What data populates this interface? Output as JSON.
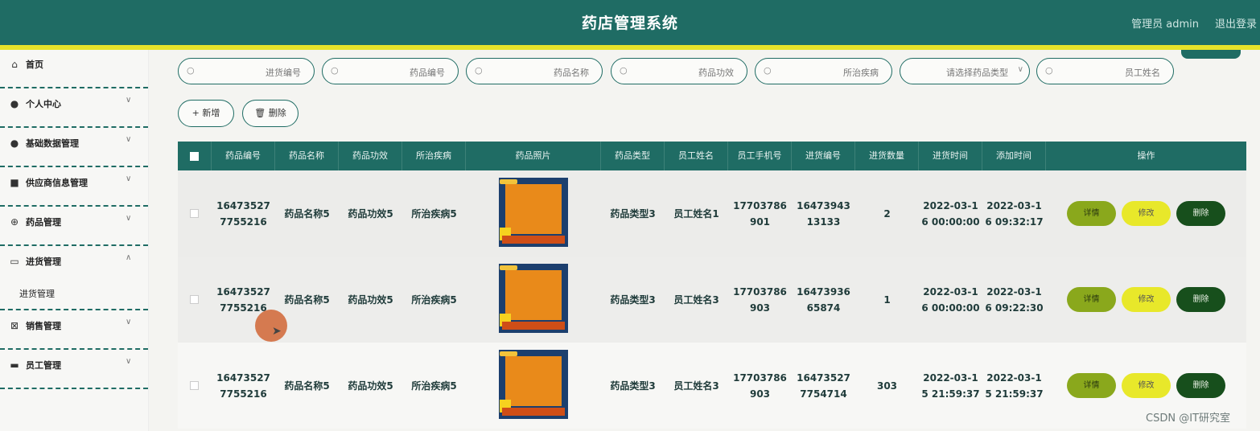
{
  "header": {
    "title": "药店管理系统",
    "admin_label": "管理员 admin",
    "logout_label": "退出登录"
  },
  "sidebar": {
    "items": [
      {
        "label": "首页",
        "icon": "home-icon"
      },
      {
        "label": "个人中心",
        "icon": "user-icon"
      },
      {
        "label": "基础数据管理",
        "icon": "pin-icon"
      },
      {
        "label": "供应商信息管理",
        "icon": "printer-icon"
      },
      {
        "label": "药品管理",
        "icon": "globe-icon"
      },
      {
        "label": "进货管理",
        "icon": "chat-icon"
      },
      {
        "label": "销售管理",
        "icon": "cross-icon"
      },
      {
        "label": "员工管理",
        "icon": "ticket-icon"
      }
    ],
    "submenu": {
      "label": "进货管理"
    }
  },
  "search": {
    "purchase_no": "进货编号",
    "drug_no": "药品编号",
    "drug_name": "药品名称",
    "drug_effect": "药品功效",
    "disease": "所治疾病",
    "drug_type": "请选择药品类型",
    "staff_name": "员工姓名"
  },
  "actions": {
    "add": "+ 新增",
    "delete": "🗑 删除"
  },
  "table": {
    "headers": [
      "药品编号",
      "药品名称",
      "药品功效",
      "所治疾病",
      "药品照片",
      "药品类型",
      "员工姓名",
      "员工手机号",
      "进货编号",
      "进货数量",
      "进货时间",
      "添加时间",
      "操作"
    ],
    "rows": [
      {
        "drug_no": "16473527 7755216",
        "drug_name": "药品名称5",
        "effect": "药品功效5",
        "disease": "所治疾病5",
        "type": "药品类型3",
        "staff": "员工姓名1",
        "phone": "17703786 901",
        "purchase_no": "16473943 13133",
        "qty": "2",
        "purchase_time": "2022-03-1 6 00:00:00",
        "add_time": "2022-03-1 6 09:32:17"
      },
      {
        "drug_no": "16473527 7755216",
        "drug_name": "药品名称5",
        "effect": "药品功效5",
        "disease": "所治疾病5",
        "type": "药品类型3",
        "staff": "员工姓名3",
        "phone": "17703786 903",
        "purchase_no": "16473936 65874",
        "qty": "1",
        "purchase_time": "2022-03-1 6 00:00:00",
        "add_time": "2022-03-1 6 09:22:30"
      },
      {
        "drug_no": "16473527 7755216",
        "drug_name": "药品名称5",
        "effect": "药品功效5",
        "disease": "所治疾病5",
        "type": "药品类型3",
        "staff": "员工姓名3",
        "phone": "17703786 903",
        "purchase_no": "16473527 7754714",
        "qty": "303",
        "purchase_time": "2022-03-1 5 21:59:37",
        "add_time": "2022-03-1 5 21:59:37"
      }
    ],
    "row_actions": {
      "detail": "详情",
      "edit": "修改",
      "delete": "删除"
    }
  },
  "watermark": "CSDN @IT研究室"
}
